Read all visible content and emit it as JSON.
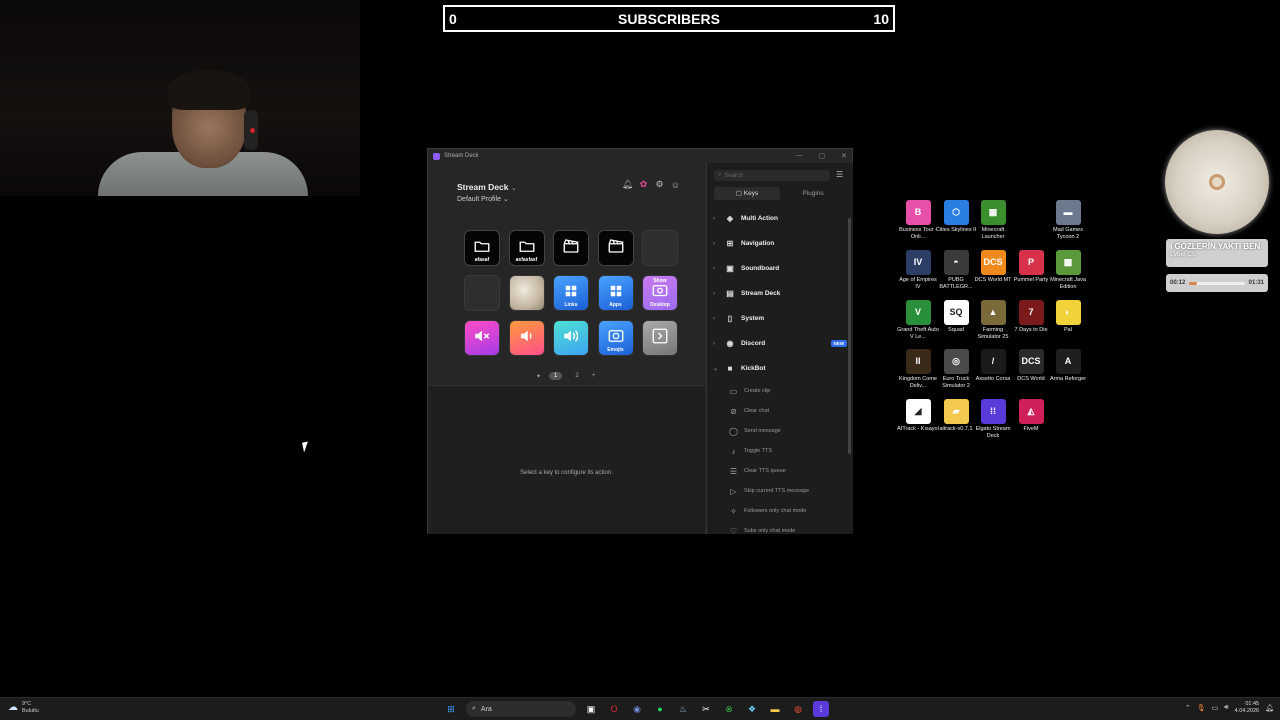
{
  "subscribers": {
    "current": "0",
    "title": "SUBSCRIBERS",
    "goal": "10"
  },
  "streamdeck": {
    "window_title": "Stream Deck",
    "device_name": "Stream Deck",
    "profile": "Default Profile",
    "keys": [
      {
        "label": "afasaf",
        "style": "k-black",
        "icon": "folder-icon"
      },
      {
        "label": "asfasfasf",
        "style": "k-black",
        "icon": "folder-icon"
      },
      {
        "label": "",
        "style": "k-black",
        "icon": "clapperboard-icon"
      },
      {
        "label": "",
        "style": "k-black",
        "icon": "clapperboard-icon"
      },
      {
        "label": "",
        "style": "key-empty",
        "icon": ""
      },
      {
        "label": "",
        "style": "key-empty",
        "icon": ""
      },
      {
        "label": "",
        "style": "k-photo",
        "icon": ""
      },
      {
        "label": "Links",
        "style": "k-blue",
        "icon": "grid-icon"
      },
      {
        "label": "Apps",
        "style": "k-blue",
        "icon": "grid-icon"
      },
      {
        "label": "Desktop",
        "top": "Show",
        "style": "k-purple",
        "icon": "eye-icon"
      },
      {
        "label": "",
        "style": "k-pink",
        "icon": "mute-icon"
      },
      {
        "label": "",
        "style": "k-orange",
        "icon": "volume-down-icon"
      },
      {
        "label": "",
        "style": "k-cyan",
        "icon": "volume-up-icon"
      },
      {
        "label": "Emojis",
        "style": "k-blue",
        "icon": "emoji-icon"
      },
      {
        "label": "",
        "style": "k-gray",
        "icon": "next-page-icon"
      }
    ],
    "pages": [
      "1",
      "2"
    ],
    "hint": "Select a key to configure its action.",
    "search_placeholder": "Search",
    "tabs": [
      "Keys",
      "Plugins"
    ],
    "categories": [
      {
        "label": "Multi Action",
        "icon": "◈"
      },
      {
        "label": "Navigation",
        "icon": "⊞"
      },
      {
        "label": "Soundboard",
        "icon": "▣"
      },
      {
        "label": "Stream Deck",
        "icon": "▤"
      },
      {
        "label": "System",
        "icon": "▯"
      },
      {
        "label": "Discord",
        "icon": "◉",
        "badge": "NEW"
      },
      {
        "label": "KickBot",
        "icon": "■",
        "expanded": true
      }
    ],
    "kickbot_actions": [
      {
        "label": "Create clip",
        "icon": "▭"
      },
      {
        "label": "Clear chat",
        "icon": "⊘"
      },
      {
        "label": "Send message",
        "icon": "◯"
      },
      {
        "label": "Toggle TTS",
        "icon": "♪"
      },
      {
        "label": "Clear TTS queue",
        "icon": "☰"
      },
      {
        "label": "Skip current TTS message",
        "icon": "▷"
      },
      {
        "label": "Followers only chat mode",
        "icon": "✧"
      },
      {
        "label": "Subs only chat mode",
        "icon": "♡"
      }
    ]
  },
  "desktop_icons": [
    {
      "label": "Business Tour - Onli...",
      "color": "#e84fa8",
      "glyph": "B"
    },
    {
      "label": "Cities Skylines II",
      "color": "#2a7de1",
      "glyph": "⬡"
    },
    {
      "label": "Minecraft Launcher",
      "color": "#3b8f2d",
      "glyph": "▦"
    },
    {
      "label": "Mad Games Tycoon 2",
      "color": "#6b7a8c",
      "glyph": "▬"
    },
    {
      "label": "Age of Empires IV",
      "color": "#2c3e66",
      "glyph": "IV"
    },
    {
      "label": "PUBG BATTLEGR...",
      "color": "#3a3a3a",
      "glyph": "◓"
    },
    {
      "label": "DCS World MT",
      "color": "#f08a1c",
      "glyph": "DCS"
    },
    {
      "label": "Pummel Party",
      "color": "#d8324a",
      "glyph": "P"
    },
    {
      "label": "Minecraft Java Edition",
      "color": "#5a9a3a",
      "glyph": "▩"
    },
    {
      "label": "Grand Theft Auto V Le...",
      "color": "#2a8f3a",
      "glyph": "V"
    },
    {
      "label": "Squad",
      "color": "#ffffff",
      "glyph": "SQ"
    },
    {
      "label": "Farming Simulator 25",
      "color": "#7a6a3a",
      "glyph": "▲"
    },
    {
      "label": "7 Days to Die",
      "color": "#7a1a1a",
      "glyph": "7"
    },
    {
      "label": "Pal",
      "color": "#f2d23a",
      "glyph": "◐"
    },
    {
      "label": "Kingdom Come Deliv...",
      "color": "#3a2a1a",
      "glyph": "II"
    },
    {
      "label": "Euro Truck Simulator 2",
      "color": "#4a4a4a",
      "glyph": "◎"
    },
    {
      "label": "Assetto Corsa",
      "color": "#1a1a1a",
      "glyph": "/"
    },
    {
      "label": "DCS World",
      "color": "#2a2a2a",
      "glyph": "DCS"
    },
    {
      "label": "Arma Reforger",
      "color": "#1f1f1f",
      "glyph": "A"
    },
    {
      "label": "AITrack - Kısayol",
      "color": "#ffffff",
      "glyph": "◢"
    },
    {
      "label": "aitrack-v0.7.1",
      "color": "#f2c94c",
      "glyph": "▰"
    },
    {
      "label": "Elgato Stream Deck",
      "color": "#5a3ad8",
      "glyph": "⁞⁞"
    },
    {
      "label": "FiveM",
      "color": "#d0205a",
      "glyph": "◭"
    }
  ],
  "music": {
    "title": "I GÖZLERİN YAKTI BEN",
    "artist": "Lvbel C5",
    "elapsed": "00:12",
    "total": "01:31",
    "progress": 0.13,
    "accent": "#d9854a"
  },
  "taskbar": {
    "weather_temp": "9°C",
    "weather_desc": "Bulutlu",
    "search_label": "Ara",
    "time": "01:45",
    "date": "4.04.2026"
  }
}
